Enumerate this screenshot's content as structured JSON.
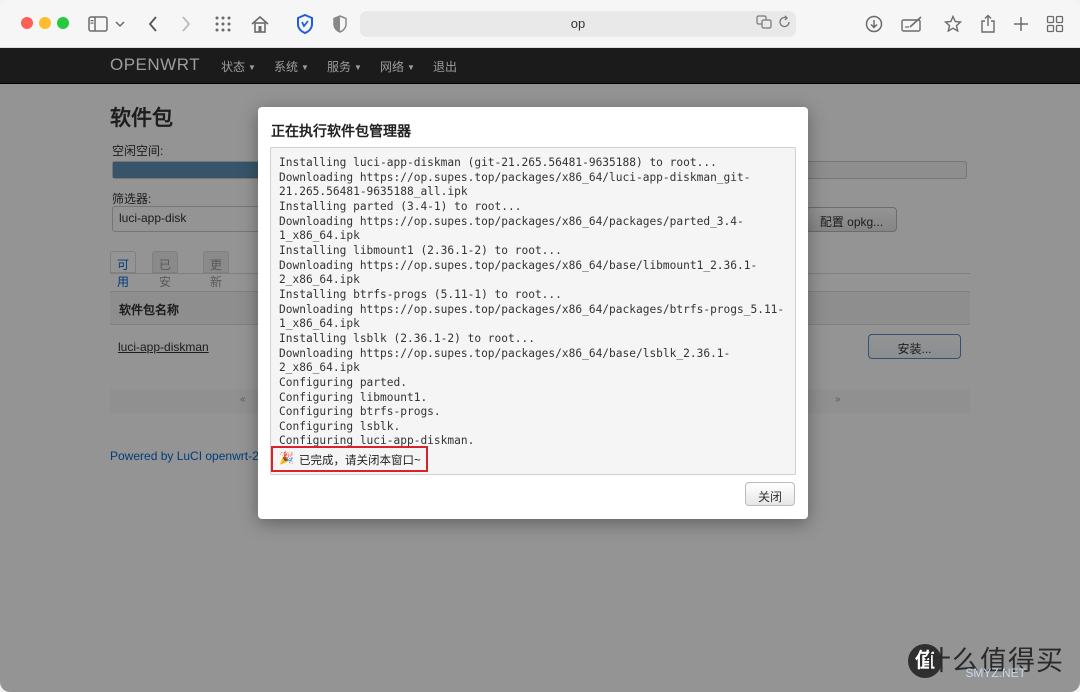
{
  "browser": {
    "address": "op",
    "icons": [
      "sidebar-icon",
      "chevron-down-icon",
      "back-icon",
      "forward-icon",
      "grid-icon",
      "home-icon",
      "shield-icon",
      "privacy-icon",
      "translate-icon",
      "reload-icon",
      "download-icon",
      "edit-icon",
      "star-icon",
      "share-icon",
      "plus-icon",
      "tabs-icon"
    ]
  },
  "nav": {
    "brand": "OPENWRT",
    "items": [
      "状态",
      "系统",
      "服务",
      "网络",
      "退出"
    ]
  },
  "page": {
    "title": "软件包",
    "free_space_label": "空闲空间:",
    "free_space_fraction": 0.17,
    "filter_label": "筛选器:",
    "filter_value": "luci-app-disk",
    "configure_button": "配置 opkg...",
    "tabs": [
      "可用",
      "已安装",
      "更新"
    ],
    "column_name": "软件包名称",
    "package_name": "luci-app-diskman",
    "install_button": "安装...",
    "pager_prev": "«",
    "pager_next": "»",
    "footer": "Powered by LuCI openwrt-2"
  },
  "modal": {
    "title": "正在执行软件包管理器",
    "log": [
      "Installing luci-app-diskman (git-21.265.56481-9635188) to root...",
      "Downloading https://op.supes.top/packages/x86_64/luci-app-diskman_git-",
      "21.265.56481-9635188_all.ipk",
      "Installing parted (3.4-1) to root...",
      "Downloading https://op.supes.top/packages/x86_64/packages/parted_3.4-",
      "1_x86_64.ipk",
      "Installing libmount1 (2.36.1-2) to root...",
      "Downloading https://op.supes.top/packages/x86_64/base/libmount1_2.36.1-",
      "2_x86_64.ipk",
      "Installing btrfs-progs (5.11-1) to root...",
      "Downloading https://op.supes.top/packages/x86_64/packages/btrfs-progs_5.11-",
      "1_x86_64.ipk",
      "Installing lsblk (2.36.1-2) to root...",
      "Downloading https://op.supes.top/packages/x86_64/base/lsblk_2.36.1-",
      "2_x86_64.ipk",
      "Configuring parted.",
      "Configuring libmount1.",
      "Configuring btrfs-progs.",
      "Configuring lsblk.",
      "Configuring luci-app-diskman."
    ],
    "done_icon": "🎉",
    "done_text": "已完成，请关闭本窗口~",
    "close_button": "关闭"
  },
  "watermark": {
    "logo": "值",
    "text": "什么值得买",
    "small": "SMYZ.NET"
  }
}
